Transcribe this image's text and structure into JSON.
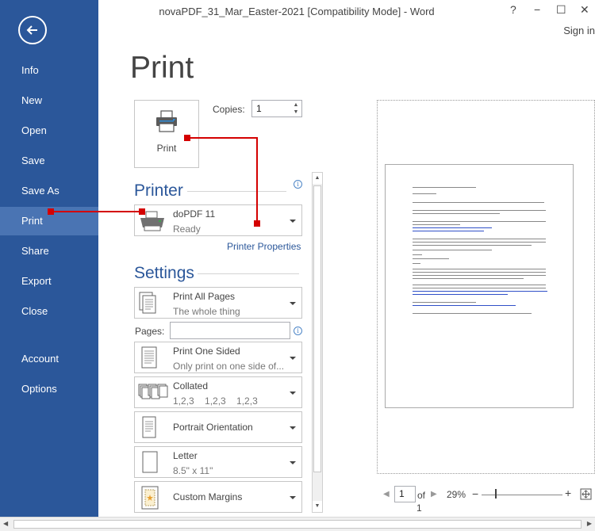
{
  "window": {
    "title": "novaPDF_31_Mar_Easter-2021 [Compatibility Mode] - Word",
    "help": "?",
    "minimize": "−",
    "maximize": "☐",
    "close": "✕",
    "sign_in": "Sign in"
  },
  "sidebar": {
    "items": [
      {
        "label": "Info"
      },
      {
        "label": "New"
      },
      {
        "label": "Open"
      },
      {
        "label": "Save"
      },
      {
        "label": "Save As"
      },
      {
        "label": "Print",
        "active": true
      },
      {
        "label": "Share"
      },
      {
        "label": "Export"
      },
      {
        "label": "Close"
      },
      {
        "label": "Account"
      },
      {
        "label": "Options"
      }
    ]
  },
  "main": {
    "heading": "Print",
    "print_button": "Print",
    "copies_label": "Copies:",
    "copies_value": "1"
  },
  "printer": {
    "section": "Printer",
    "name": "doPDF 11",
    "status": "Ready",
    "properties_link": "Printer Properties"
  },
  "settings": {
    "section": "Settings",
    "pages_label": "Pages:",
    "pages_value": "",
    "options": [
      {
        "title": "Print All Pages",
        "subtitle": "The whole thing"
      },
      {
        "title": "Print One Sided",
        "subtitle": "Only print on one side of..."
      },
      {
        "title": "Collated",
        "subtitle": "1,2,3    1,2,3    1,2,3"
      },
      {
        "title": "Portrait Orientation",
        "subtitle": ""
      },
      {
        "title": "Letter",
        "subtitle": "8.5\" x 11\""
      },
      {
        "title": "Custom Margins",
        "subtitle": ""
      }
    ]
  },
  "preview": {
    "page": "1",
    "of_label": "of",
    "total": "1",
    "zoom": "29%",
    "zoom_out": "−",
    "zoom_in": "+"
  },
  "colors": {
    "sidebar": "#2b579a",
    "sidebar_active": "#4a74b3",
    "accent": "#2b579a",
    "annotation": "#d40000"
  }
}
